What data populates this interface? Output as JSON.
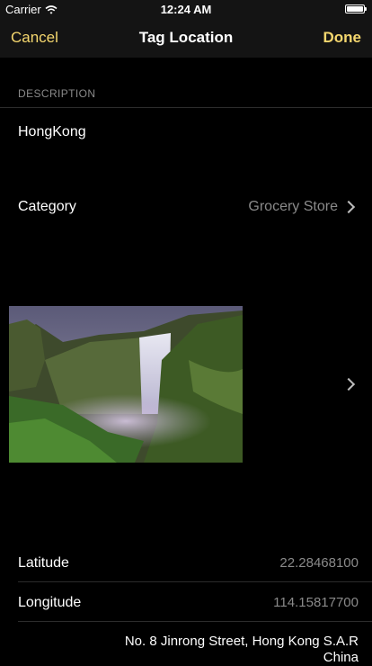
{
  "status_bar": {
    "carrier": "Carrier",
    "time": "12:24 AM"
  },
  "nav": {
    "cancel": "Cancel",
    "title": "Tag Location",
    "done": "Done"
  },
  "description": {
    "header": "DESCRIPTION",
    "value": "HongKong"
  },
  "category": {
    "label": "Category",
    "value": "Grocery Store"
  },
  "location": {
    "latitude_label": "Latitude",
    "latitude": "22.28468100",
    "longitude_label": "Longitude",
    "longitude": "114.15817700",
    "address_line1": "No. 8 Jinrong Street, Hong Kong S.A.R",
    "address_line2": "China"
  },
  "colors": {
    "accent": "#f5d76e",
    "background": "#000000",
    "bar": "#141414",
    "secondary_text": "#8a8a8a"
  }
}
